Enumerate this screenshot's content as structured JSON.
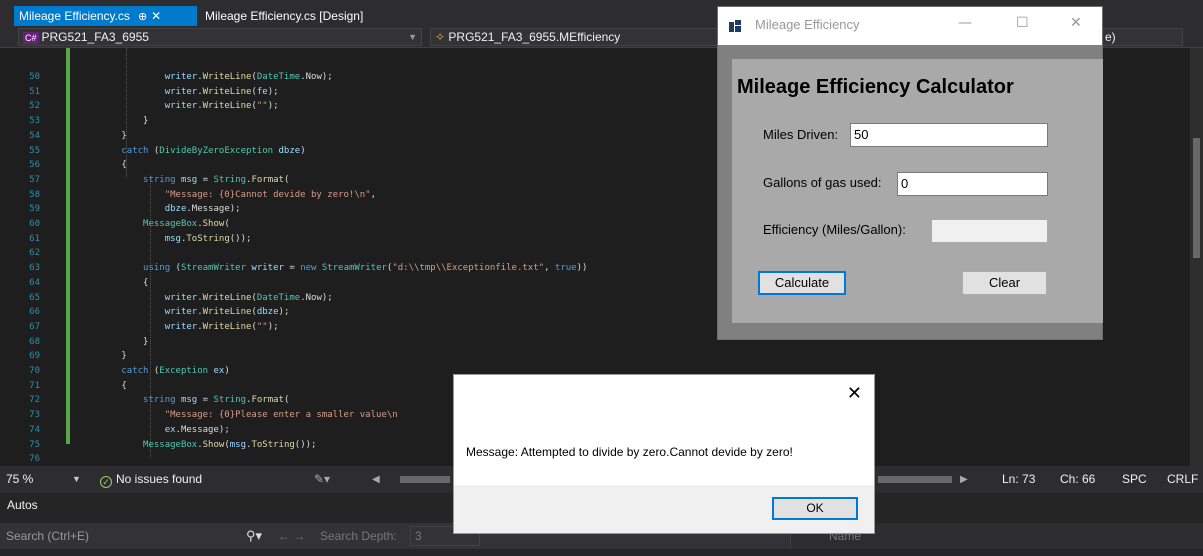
{
  "ide": {
    "tabs": [
      {
        "label": "Mileage Efficiency.cs",
        "pin": "⊕",
        "close": "✕",
        "active": true
      },
      {
        "label": "Mileage Efficiency.cs [Design]",
        "active": false
      }
    ],
    "nav": {
      "project_badge": "C#",
      "project": "PRG521_FA3_6955",
      "class_path": "PRG521_FA3_6955.MEfficiency",
      "member_fragment": "e)"
    },
    "line_numbers": [
      "50",
      "51",
      "52",
      "53",
      "54",
      "55",
      "56",
      "57",
      "58",
      "59",
      "60",
      "61",
      "62",
      "63",
      "64",
      "65",
      "66",
      "67",
      "68",
      "69",
      "70",
      "71",
      "72",
      "73",
      "74",
      "75",
      "76"
    ],
    "code_lines": [
      "                writer.WriteLine(DateTime.Now);",
      "                writer.WriteLine(fe);",
      "                writer.WriteLine(\"\");",
      "            }",
      "        }",
      "        catch (DivideByZeroException dbze)",
      "        {",
      "            string msg = String.Format(",
      "                \"Message: {0}Cannot devide by zero!\\n\",",
      "                dbze.Message);",
      "            MessageBox.Show(",
      "                msg.ToString());",
      "",
      "            using (StreamWriter writer = new StreamWriter(\"d:\\\\tmp\\\\Exceptionfile.txt\", true))",
      "            {",
      "                writer.WriteLine(DateTime.Now);",
      "                writer.WriteLine(dbze);",
      "                writer.WriteLine(\"\");",
      "            }",
      "        }",
      "        catch (Exception ex)",
      "        {",
      "            string msg = String.Format(",
      "                \"Message: {0}Please enter a smaller value\\n",
      "                ex.Message);",
      "            MessageBox.Show(msg.ToString());",
      ""
    ],
    "status": {
      "zoom": "75 %",
      "issues": "No issues found",
      "ln": "Ln: 73",
      "ch": "Ch: 66",
      "spc": "SPC",
      "crlf": "CRLF"
    },
    "autos": {
      "title": "Autos",
      "search_placeholder": "Search (Ctrl+E)",
      "search_depth_label": "Search Depth:",
      "search_depth_value": "3",
      "name_column": "Name"
    },
    "colors": {
      "accent": "#007acc",
      "editor_bg": "#1e1e1e",
      "line_number": "#2b91af"
    }
  },
  "form": {
    "window_title": "Mileage Efficiency",
    "heading": "Mileage Efficiency Calculator",
    "miles_label": "Miles Driven:",
    "miles_value": "50",
    "gallons_label": "Gallons of gas used:",
    "gallons_value": "0",
    "efficiency_label": "Efficiency (Miles/Gallon):",
    "efficiency_value": "",
    "calculate_label": "Calculate",
    "clear_label": "Clear",
    "minimize": "—",
    "maximize": "☐",
    "close": "✕"
  },
  "message_box": {
    "text": "Message: Attempted to divide by zero.Cannot devide by zero!",
    "ok_label": "OK",
    "close": "✕"
  }
}
